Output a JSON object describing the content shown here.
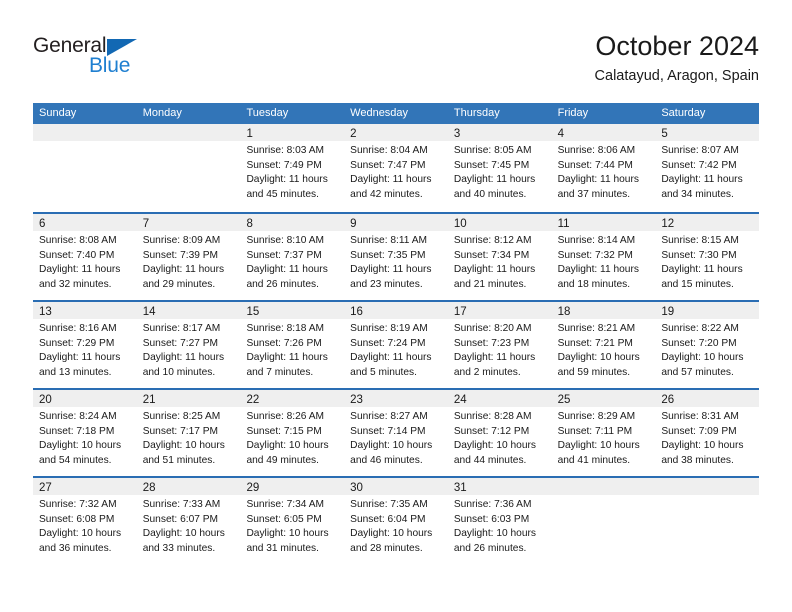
{
  "logo": {
    "word1": "General",
    "word2": "Blue",
    "triangle_color": "#1268b3",
    "word2_color": "#1f7fd0"
  },
  "header": {
    "title": "October 2024",
    "subtitle": "Calatayud, Aragon, Spain"
  },
  "colors": {
    "header_bar": "#3275b8",
    "row_divider": "#2a6db3",
    "day_band": "#efefef",
    "text": "#1a1a1a"
  },
  "weekdays": [
    "Sunday",
    "Monday",
    "Tuesday",
    "Wednesday",
    "Thursday",
    "Friday",
    "Saturday"
  ],
  "weeks": [
    [
      {
        "day": "",
        "lines": []
      },
      {
        "day": "",
        "lines": []
      },
      {
        "day": "1",
        "lines": [
          "Sunrise: 8:03 AM",
          "Sunset: 7:49 PM",
          "Daylight: 11 hours",
          "and 45 minutes."
        ]
      },
      {
        "day": "2",
        "lines": [
          "Sunrise: 8:04 AM",
          "Sunset: 7:47 PM",
          "Daylight: 11 hours",
          "and 42 minutes."
        ]
      },
      {
        "day": "3",
        "lines": [
          "Sunrise: 8:05 AM",
          "Sunset: 7:45 PM",
          "Daylight: 11 hours",
          "and 40 minutes."
        ]
      },
      {
        "day": "4",
        "lines": [
          "Sunrise: 8:06 AM",
          "Sunset: 7:44 PM",
          "Daylight: 11 hours",
          "and 37 minutes."
        ]
      },
      {
        "day": "5",
        "lines": [
          "Sunrise: 8:07 AM",
          "Sunset: 7:42 PM",
          "Daylight: 11 hours",
          "and 34 minutes."
        ]
      }
    ],
    [
      {
        "day": "6",
        "lines": [
          "Sunrise: 8:08 AM",
          "Sunset: 7:40 PM",
          "Daylight: 11 hours",
          "and 32 minutes."
        ]
      },
      {
        "day": "7",
        "lines": [
          "Sunrise: 8:09 AM",
          "Sunset: 7:39 PM",
          "Daylight: 11 hours",
          "and 29 minutes."
        ]
      },
      {
        "day": "8",
        "lines": [
          "Sunrise: 8:10 AM",
          "Sunset: 7:37 PM",
          "Daylight: 11 hours",
          "and 26 minutes."
        ]
      },
      {
        "day": "9",
        "lines": [
          "Sunrise: 8:11 AM",
          "Sunset: 7:35 PM",
          "Daylight: 11 hours",
          "and 23 minutes."
        ]
      },
      {
        "day": "10",
        "lines": [
          "Sunrise: 8:12 AM",
          "Sunset: 7:34 PM",
          "Daylight: 11 hours",
          "and 21 minutes."
        ]
      },
      {
        "day": "11",
        "lines": [
          "Sunrise: 8:14 AM",
          "Sunset: 7:32 PM",
          "Daylight: 11 hours",
          "and 18 minutes."
        ]
      },
      {
        "day": "12",
        "lines": [
          "Sunrise: 8:15 AM",
          "Sunset: 7:30 PM",
          "Daylight: 11 hours",
          "and 15 minutes."
        ]
      }
    ],
    [
      {
        "day": "13",
        "lines": [
          "Sunrise: 8:16 AM",
          "Sunset: 7:29 PM",
          "Daylight: 11 hours",
          "and 13 minutes."
        ]
      },
      {
        "day": "14",
        "lines": [
          "Sunrise: 8:17 AM",
          "Sunset: 7:27 PM",
          "Daylight: 11 hours",
          "and 10 minutes."
        ]
      },
      {
        "day": "15",
        "lines": [
          "Sunrise: 8:18 AM",
          "Sunset: 7:26 PM",
          "Daylight: 11 hours",
          "and 7 minutes."
        ]
      },
      {
        "day": "16",
        "lines": [
          "Sunrise: 8:19 AM",
          "Sunset: 7:24 PM",
          "Daylight: 11 hours",
          "and 5 minutes."
        ]
      },
      {
        "day": "17",
        "lines": [
          "Sunrise: 8:20 AM",
          "Sunset: 7:23 PM",
          "Daylight: 11 hours",
          "and 2 minutes."
        ]
      },
      {
        "day": "18",
        "lines": [
          "Sunrise: 8:21 AM",
          "Sunset: 7:21 PM",
          "Daylight: 10 hours",
          "and 59 minutes."
        ]
      },
      {
        "day": "19",
        "lines": [
          "Sunrise: 8:22 AM",
          "Sunset: 7:20 PM",
          "Daylight: 10 hours",
          "and 57 minutes."
        ]
      }
    ],
    [
      {
        "day": "20",
        "lines": [
          "Sunrise: 8:24 AM",
          "Sunset: 7:18 PM",
          "Daylight: 10 hours",
          "and 54 minutes."
        ]
      },
      {
        "day": "21",
        "lines": [
          "Sunrise: 8:25 AM",
          "Sunset: 7:17 PM",
          "Daylight: 10 hours",
          "and 51 minutes."
        ]
      },
      {
        "day": "22",
        "lines": [
          "Sunrise: 8:26 AM",
          "Sunset: 7:15 PM",
          "Daylight: 10 hours",
          "and 49 minutes."
        ]
      },
      {
        "day": "23",
        "lines": [
          "Sunrise: 8:27 AM",
          "Sunset: 7:14 PM",
          "Daylight: 10 hours",
          "and 46 minutes."
        ]
      },
      {
        "day": "24",
        "lines": [
          "Sunrise: 8:28 AM",
          "Sunset: 7:12 PM",
          "Daylight: 10 hours",
          "and 44 minutes."
        ]
      },
      {
        "day": "25",
        "lines": [
          "Sunrise: 8:29 AM",
          "Sunset: 7:11 PM",
          "Daylight: 10 hours",
          "and 41 minutes."
        ]
      },
      {
        "day": "26",
        "lines": [
          "Sunrise: 8:31 AM",
          "Sunset: 7:09 PM",
          "Daylight: 10 hours",
          "and 38 minutes."
        ]
      }
    ],
    [
      {
        "day": "27",
        "lines": [
          "Sunrise: 7:32 AM",
          "Sunset: 6:08 PM",
          "Daylight: 10 hours",
          "and 36 minutes."
        ]
      },
      {
        "day": "28",
        "lines": [
          "Sunrise: 7:33 AM",
          "Sunset: 6:07 PM",
          "Daylight: 10 hours",
          "and 33 minutes."
        ]
      },
      {
        "day": "29",
        "lines": [
          "Sunrise: 7:34 AM",
          "Sunset: 6:05 PM",
          "Daylight: 10 hours",
          "and 31 minutes."
        ]
      },
      {
        "day": "30",
        "lines": [
          "Sunrise: 7:35 AM",
          "Sunset: 6:04 PM",
          "Daylight: 10 hours",
          "and 28 minutes."
        ]
      },
      {
        "day": "31",
        "lines": [
          "Sunrise: 7:36 AM",
          "Sunset: 6:03 PM",
          "Daylight: 10 hours",
          "and 26 minutes."
        ]
      },
      {
        "day": "",
        "lines": []
      },
      {
        "day": "",
        "lines": []
      }
    ]
  ]
}
